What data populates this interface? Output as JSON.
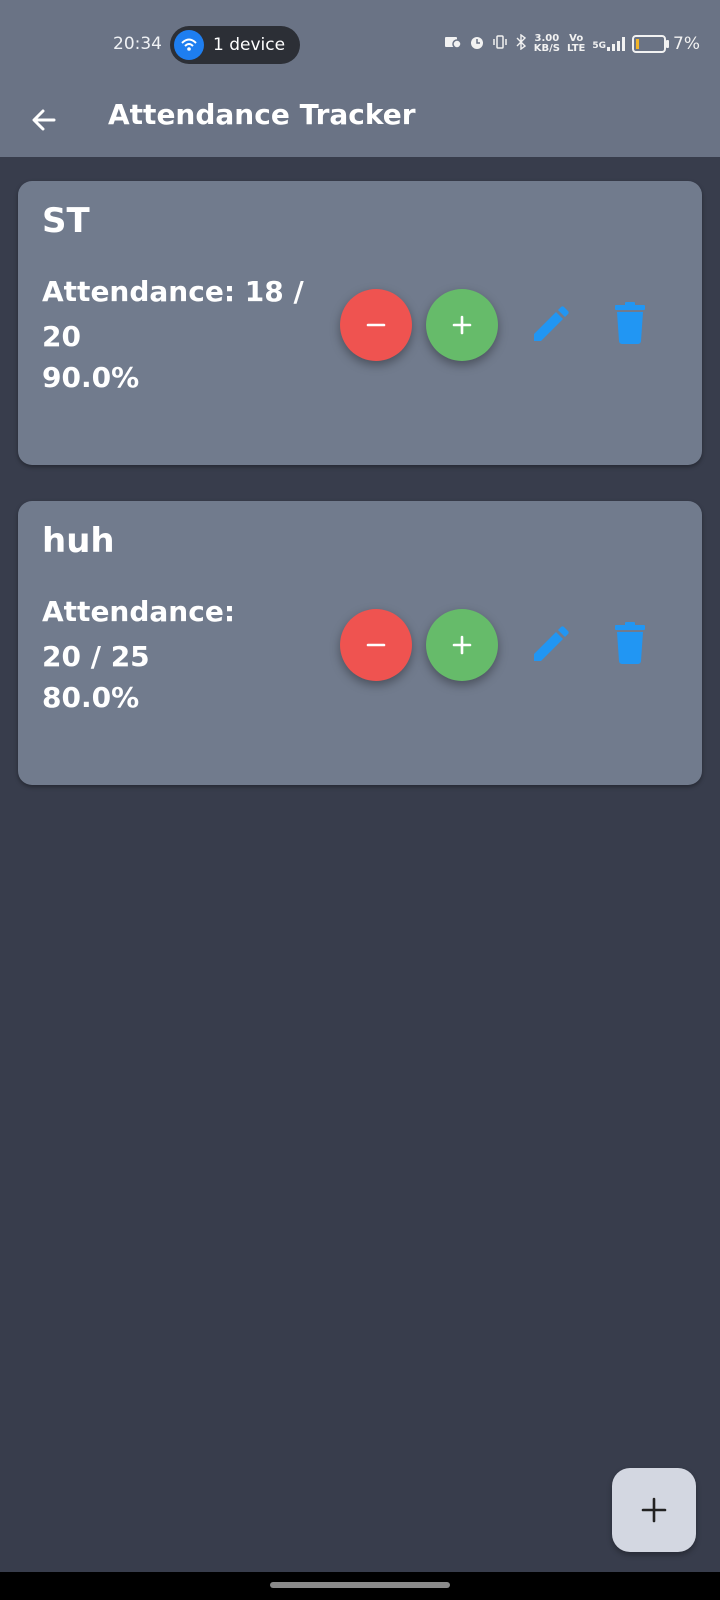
{
  "status_bar": {
    "time": "20:34",
    "hotspot_label": "1 device",
    "net_speed_value": "3.00",
    "net_speed_unit": "KB/S",
    "volte_top": "Vo",
    "volte_bottom": "LTE",
    "network_type": "5G",
    "battery_percent": "7%",
    "battery_level": 0.07
  },
  "app_bar": {
    "title": "Attendance Tracker",
    "back_icon": "arrow-left-icon"
  },
  "subjects": [
    {
      "name": "ST",
      "attendance_label": "Attendance: 18 / 20",
      "percent": "90.0%"
    },
    {
      "name": "huh",
      "attendance_label": "Attendance: 20 / 25",
      "percent": "80.0%"
    }
  ],
  "actions": {
    "decrement_icon": "minus-icon",
    "increment_icon": "plus-icon",
    "edit_icon": "pencil-icon",
    "delete_icon": "trash-icon"
  },
  "fab": {
    "icon": "plus-icon"
  },
  "colors": {
    "app_bar": "#6a7385",
    "background": "#383d4c",
    "card": "#717b8d",
    "decrement": "#ef5350",
    "increment": "#66bb6a",
    "icon_accent": "#2196f3",
    "fab": "#d3d7e1"
  }
}
